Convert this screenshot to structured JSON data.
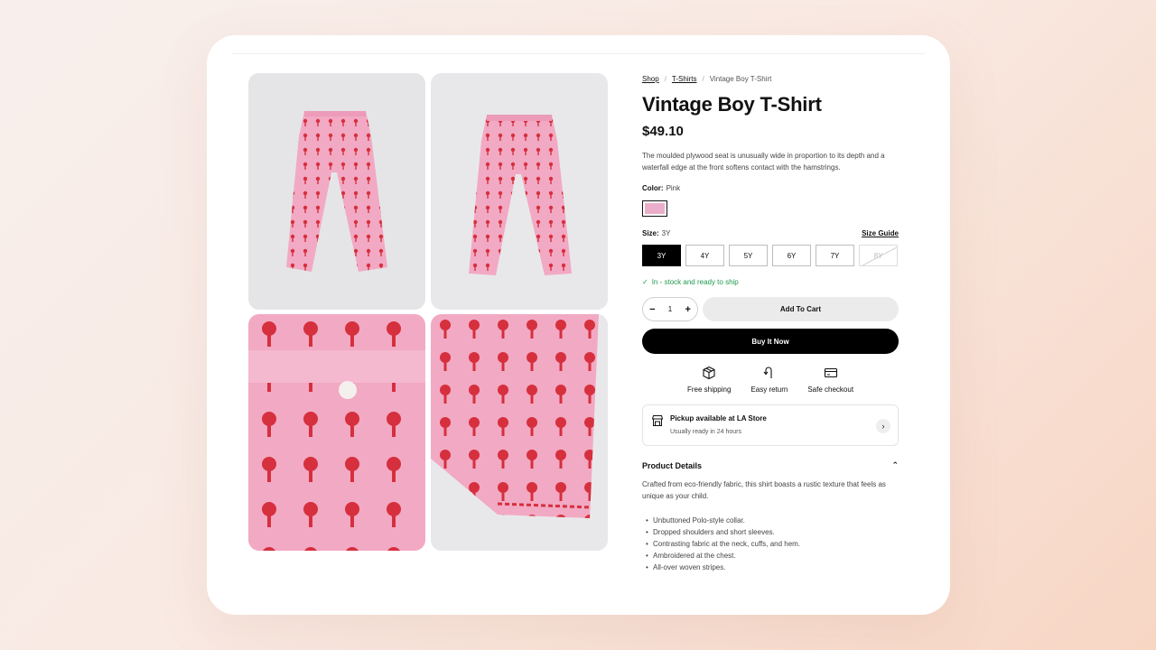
{
  "breadcrumb": [
    "Shop",
    "T-Shirts",
    "Vintage Boy T-Shirt"
  ],
  "product": {
    "title": "Vintage Boy T-Shirt",
    "price": "$49.10",
    "description": "The moulded plywood seat is unusually wide in proportion to its depth and a waterfall edge at the front softens contact with the hamstrings."
  },
  "color": {
    "label": "Color:",
    "value": "Pink",
    "swatch_hex": "#eaaecb"
  },
  "size": {
    "label": "Size:",
    "value": "3Y",
    "guide": "Size Guide",
    "options": [
      "3Y",
      "4Y",
      "5Y",
      "6Y",
      "7Y",
      "8Y"
    ],
    "selected": "3Y",
    "unavailable": [
      "8Y"
    ]
  },
  "stock": "In - stock and ready to ship",
  "quantity": {
    "value": "1",
    "minus": "−",
    "plus": "+"
  },
  "buttons": {
    "add_to_cart": "Add To Cart",
    "buy_now": "Buy It Now"
  },
  "perks": [
    {
      "label": "Free shipping",
      "icon": "box-icon"
    },
    {
      "label": "Easy return",
      "icon": "return-icon"
    },
    {
      "label": "Safe checkout",
      "icon": "card-icon"
    }
  ],
  "pickup": {
    "title": "Pickup available at LA Store",
    "subtitle": "Usually ready in 24 hours",
    "icon": "store-icon"
  },
  "details": {
    "heading": "Product Details",
    "text": "Crafted from eco-friendly fabric, this shirt boasts a rustic texture that feels as unique as your child.",
    "bullets": [
      "Unbuttoned Polo-style collar.",
      "Dropped shoulders and short sleeves.",
      "Contrasting fabric at the neck, cuffs, and hem.",
      "Ambroidered at the chest.",
      "All-over woven stripes."
    ]
  },
  "colors": {
    "accent": "#000000",
    "success": "#1f9a4d",
    "fabric": "#f2a9c3",
    "print": "#d62f3e"
  }
}
